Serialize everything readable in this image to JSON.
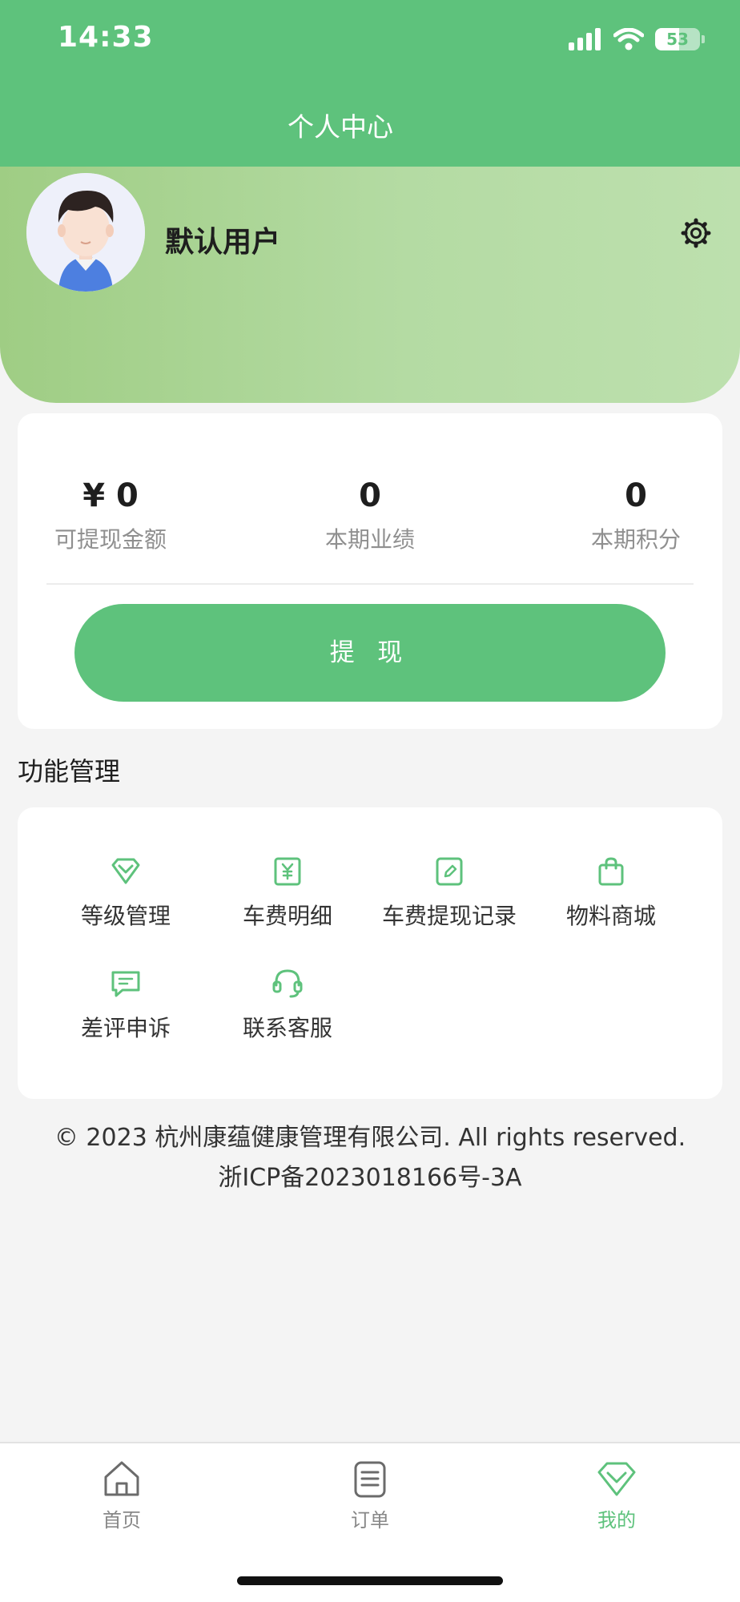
{
  "status_bar": {
    "time": "14:33",
    "battery": "53",
    "battery_level": 0.53
  },
  "header": {
    "title": "个人中心"
  },
  "profile": {
    "username": "默认用户"
  },
  "stats": [
    {
      "value": "¥ 0",
      "label": "可提现金额"
    },
    {
      "value": "0",
      "label": "本期业绩"
    },
    {
      "value": "0",
      "label": "本期积分"
    }
  ],
  "withdraw": {
    "label": "提 现"
  },
  "functions": {
    "title": "功能管理",
    "items": [
      {
        "label": "等级管理",
        "icon": "diamond-icon"
      },
      {
        "label": "车费明细",
        "icon": "yuan-receipt-icon"
      },
      {
        "label": "车费提现记录",
        "icon": "edit-note-icon"
      },
      {
        "label": "物料商城",
        "icon": "shopping-bag-icon"
      },
      {
        "label": "差评申诉",
        "icon": "message-icon"
      },
      {
        "label": "联系客服",
        "icon": "headset-icon"
      }
    ]
  },
  "footer": {
    "copyright": "© 2023 杭州康蕴健康管理有限公司. All rights reserved.",
    "icp": "浙ICP备2023018166号-3A"
  },
  "tabbar": {
    "items": [
      {
        "label": "首页",
        "icon": "home-icon",
        "active": false
      },
      {
        "label": "订单",
        "icon": "order-list-icon",
        "active": false
      },
      {
        "label": "我的",
        "icon": "diamond-icon",
        "active": true
      }
    ]
  },
  "colors": {
    "primary": "#5ec27c",
    "background": "#f4f4f4"
  }
}
